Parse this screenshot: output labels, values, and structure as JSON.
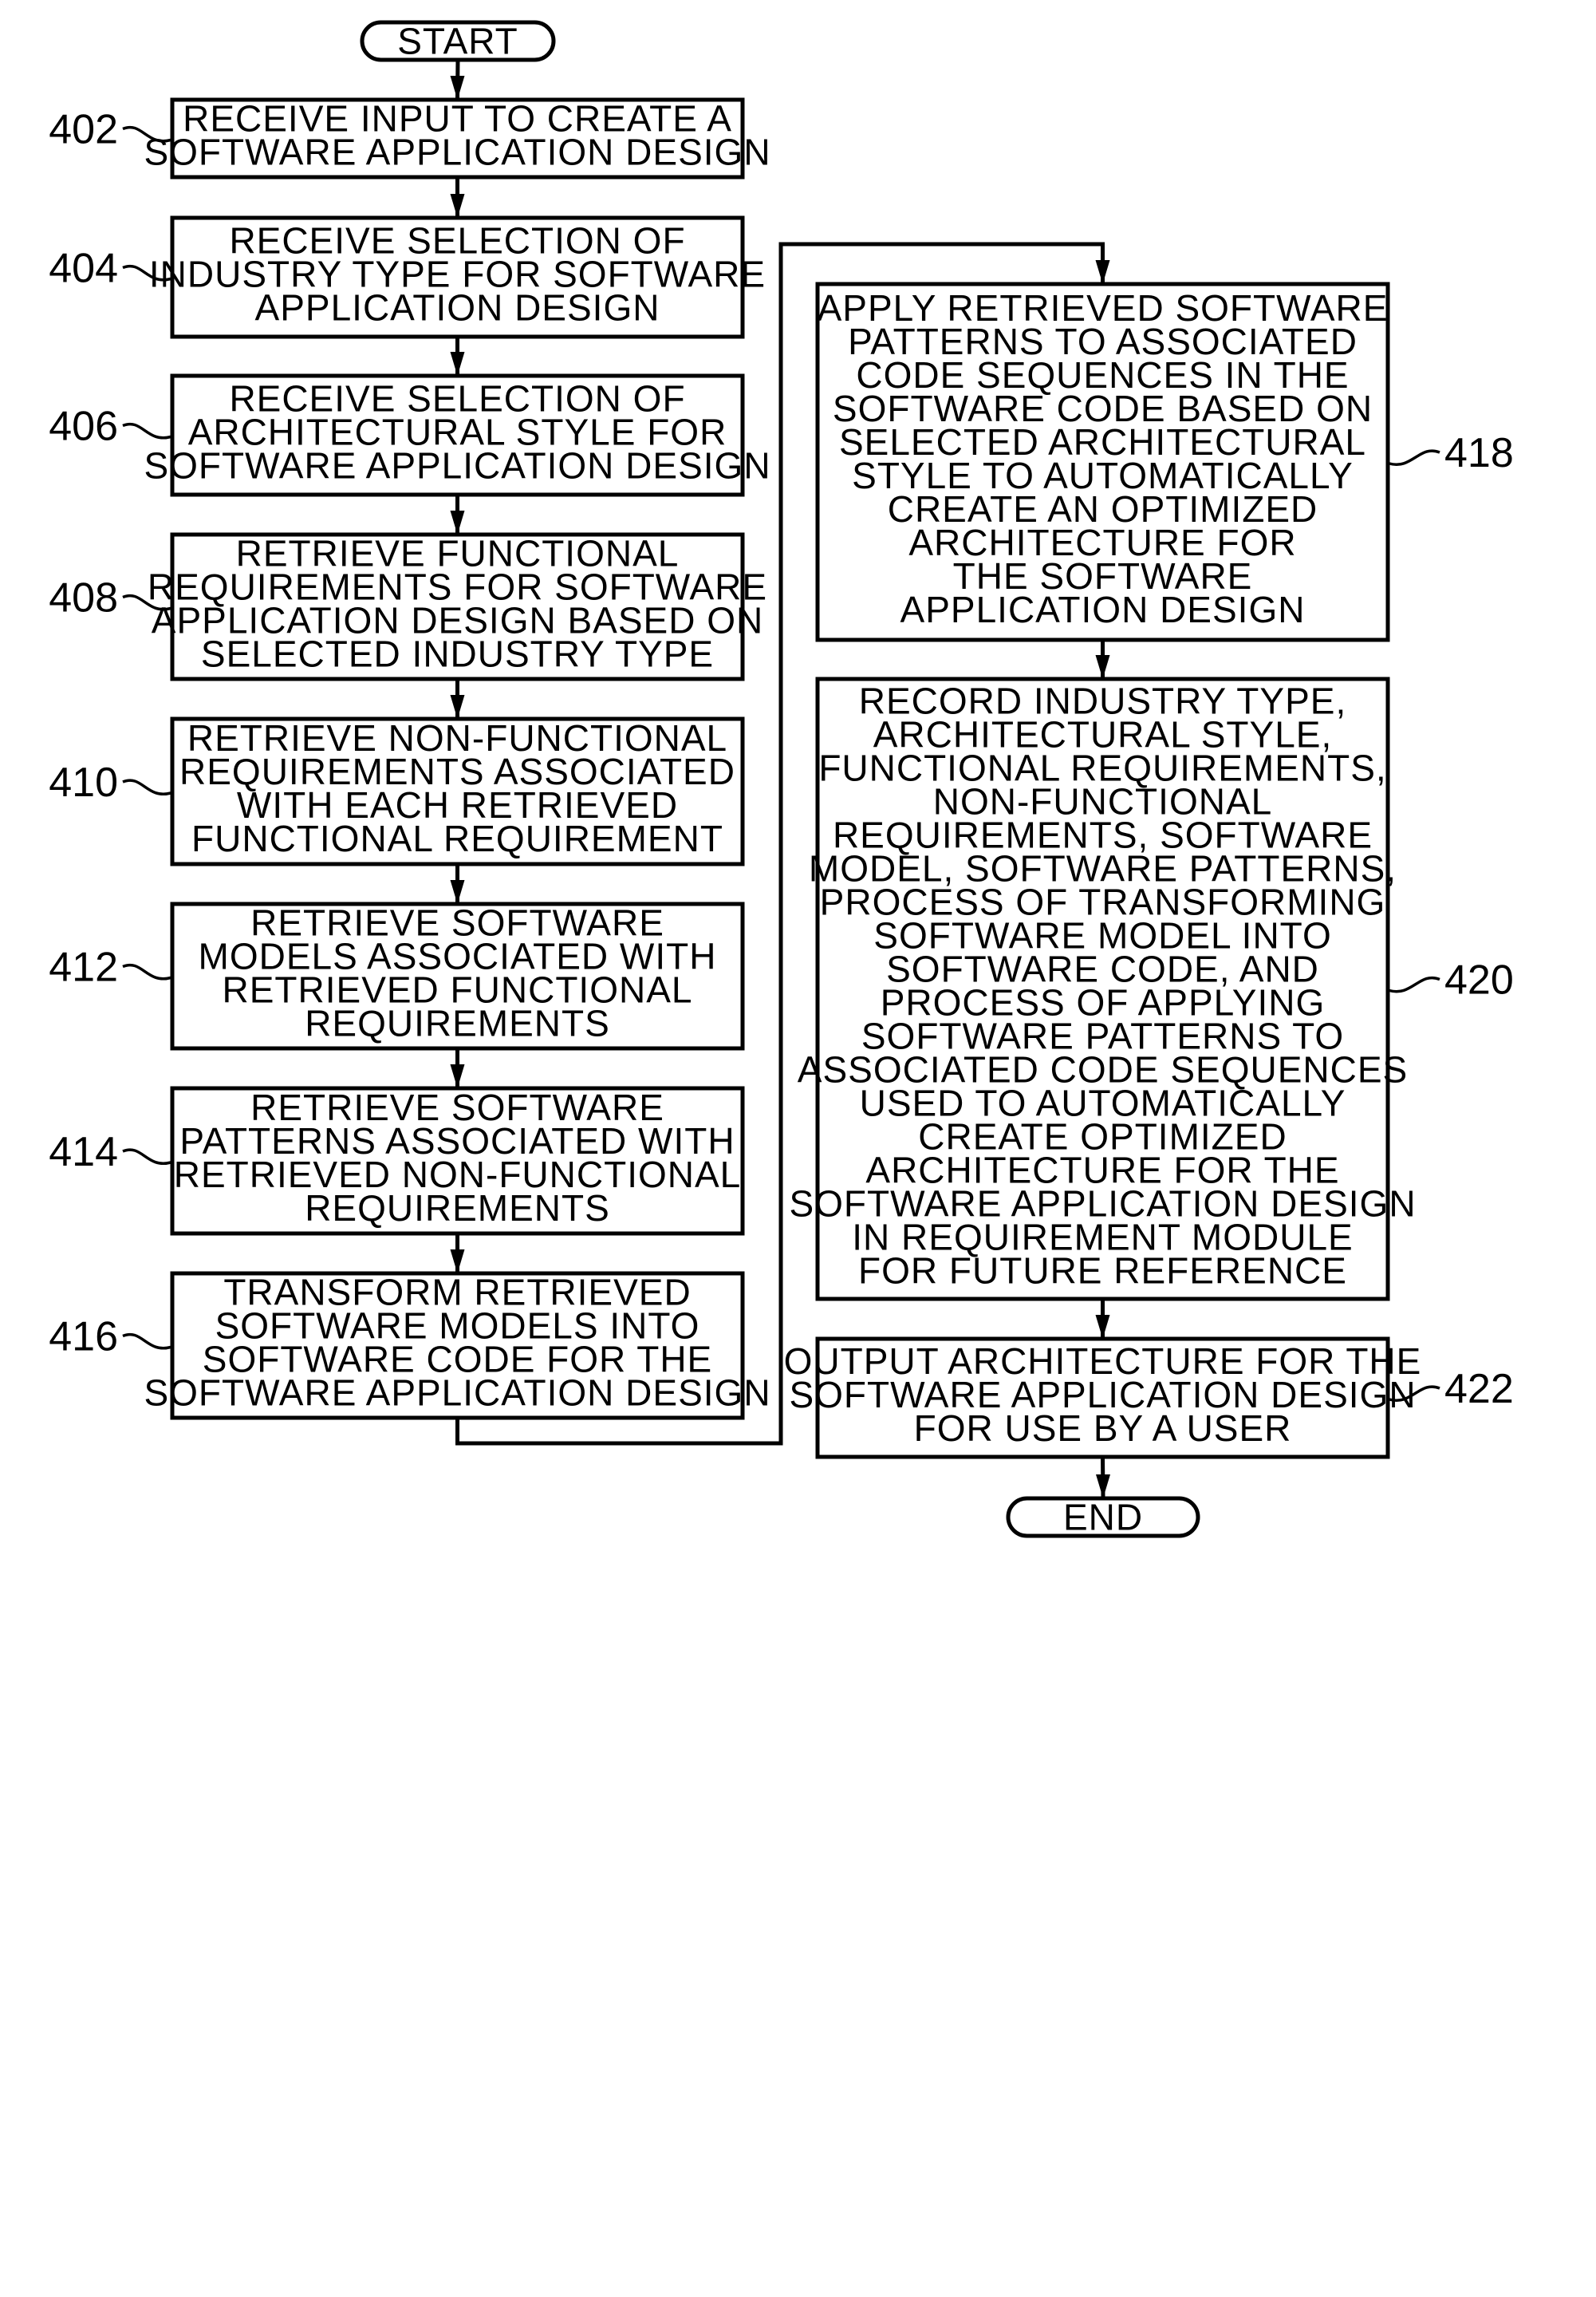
{
  "diagram": {
    "type": "flowchart",
    "start": {
      "label": "START"
    },
    "end": {
      "label": "END"
    },
    "steps": [
      {
        "ref": "402",
        "column": "left",
        "lines": [
          "RECEIVE INPUT TO CREATE  A",
          "SOFTWARE APPLICATION DESIGN"
        ]
      },
      {
        "ref": "404",
        "column": "left",
        "lines": [
          "RECEIVE SELECTION OF",
          "INDUSTRY TYPE FOR SOFTWARE",
          "APPLICATION DESIGN"
        ]
      },
      {
        "ref": "406",
        "column": "left",
        "lines": [
          "RECEIVE SELECTION OF",
          "ARCHITECTURAL STYLE FOR",
          "SOFTWARE APPLICATION DESIGN"
        ]
      },
      {
        "ref": "408",
        "column": "left",
        "lines": [
          "RETRIEVE FUNCTIONAL",
          "REQUIREMENTS FOR SOFTWARE",
          "APPLICATION DESIGN BASED ON",
          "SELECTED INDUSTRY TYPE"
        ]
      },
      {
        "ref": "410",
        "column": "left",
        "lines": [
          "RETRIEVE NON-FUNCTIONAL",
          "REQUIREMENTS ASSOCIATED",
          "WITH EACH RETRIEVED",
          "FUNCTIONAL REQUIREMENT"
        ]
      },
      {
        "ref": "412",
        "column": "left",
        "lines": [
          "RETRIEVE SOFTWARE",
          "MODELS ASSOCIATED WITH",
          "RETRIEVED FUNCTIONAL",
          "REQUIREMENTS"
        ]
      },
      {
        "ref": "414",
        "column": "left",
        "lines": [
          "RETRIEVE SOFTWARE",
          "PATTERNS ASSOCIATED WITH",
          "RETRIEVED NON-FUNCTIONAL",
          "REQUIREMENTS"
        ]
      },
      {
        "ref": "416",
        "column": "left",
        "lines": [
          "TRANSFORM RETRIEVED",
          "SOFTWARE MODELS INTO",
          "SOFTWARE CODE FOR THE",
          "SOFTWARE APPLICATION DESIGN"
        ]
      },
      {
        "ref": "418",
        "column": "right",
        "lines": [
          "APPLY RETRIEVED SOFTWARE",
          "PATTERNS TO ASSOCIATED",
          "CODE SEQUENCES IN THE",
          "SOFTWARE CODE BASED ON",
          "SELECTED ARCHITECTURAL",
          "STYLE TO AUTOMATICALLY",
          "CREATE AN OPTIMIZED",
          "ARCHITECTURE FOR",
          "THE SOFTWARE",
          "APPLICATION DESIGN"
        ]
      },
      {
        "ref": "420",
        "column": "right",
        "lines": [
          "RECORD INDUSTRY TYPE,",
          "ARCHITECTURAL STYLE,",
          "FUNCTIONAL REQUIREMENTS,",
          "NON-FUNCTIONAL",
          "REQUIREMENTS, SOFTWARE",
          "MODEL, SOFTWARE PATTERNS,",
          "PROCESS OF TRANSFORMING",
          "SOFTWARE MODEL INTO",
          "SOFTWARE CODE, AND",
          "PROCESS OF APPLYING",
          "SOFTWARE PATTERNS TO",
          "ASSOCIATED CODE SEQUENCES",
          "USED TO AUTOMATICALLY",
          "CREATE OPTIMIZED",
          "ARCHITECTURE FOR THE",
          "SOFTWARE APPLICATION DESIGN",
          "IN REQUIREMENT MODULE",
          "FOR FUTURE REFERENCE"
        ]
      },
      {
        "ref": "422",
        "column": "right",
        "lines": [
          "OUTPUT ARCHITECTURE FOR THE",
          "SOFTWARE APPLICATION DESIGN",
          "FOR USE BY A USER"
        ]
      }
    ],
    "edges": [
      [
        "start",
        "402"
      ],
      [
        "402",
        "404"
      ],
      [
        "404",
        "406"
      ],
      [
        "406",
        "408"
      ],
      [
        "408",
        "410"
      ],
      [
        "410",
        "412"
      ],
      [
        "412",
        "414"
      ],
      [
        "414",
        "416"
      ],
      [
        "416",
        "418"
      ],
      [
        "418",
        "420"
      ],
      [
        "420",
        "422"
      ],
      [
        "422",
        "end"
      ]
    ]
  }
}
